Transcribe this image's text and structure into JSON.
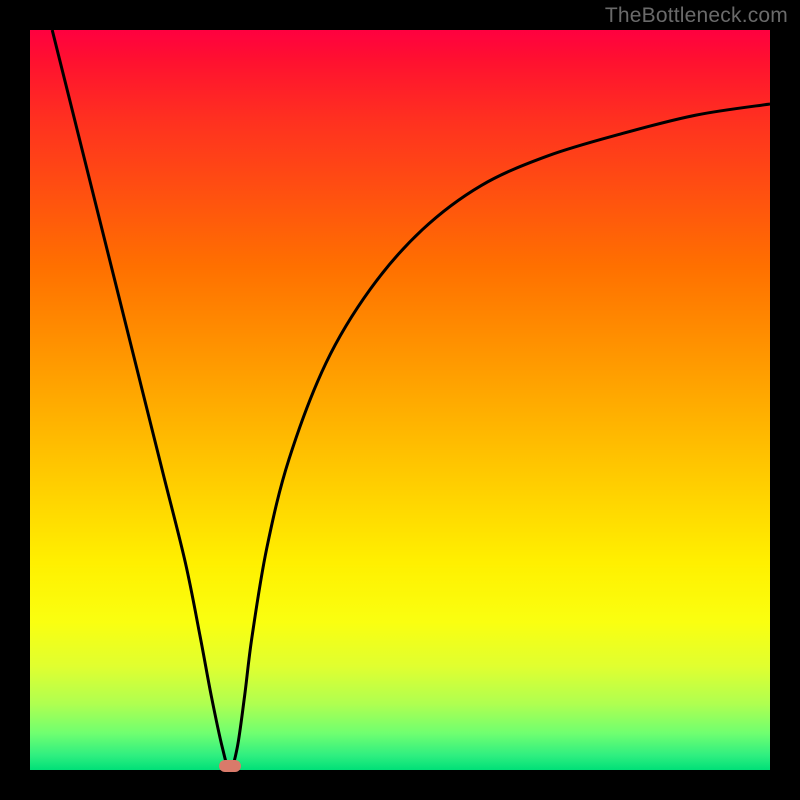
{
  "watermark": "TheBottleneck.com",
  "chart_data": {
    "type": "line",
    "title": "",
    "xlabel": "",
    "ylabel": "",
    "xlim": [
      0,
      100
    ],
    "ylim": [
      0,
      100
    ],
    "grid": false,
    "series": [
      {
        "name": "curve",
        "x": [
          3,
          6,
          9,
          12,
          15,
          18,
          21,
          23,
          24.5,
          26,
          27,
          28,
          29,
          30,
          32,
          35,
          40,
          46,
          53,
          61,
          70,
          80,
          90,
          100
        ],
        "y": [
          100,
          88,
          76,
          64,
          52,
          40,
          28,
          18,
          10,
          3,
          0,
          3,
          10,
          18,
          30,
          42,
          55,
          65,
          73,
          79,
          83,
          86,
          88.5,
          90
        ]
      }
    ],
    "marker": {
      "x": 27,
      "y": 0.5
    },
    "background_gradient": {
      "top": "#ff0040",
      "mid": "#ffd000",
      "bottom": "#00e078"
    }
  }
}
